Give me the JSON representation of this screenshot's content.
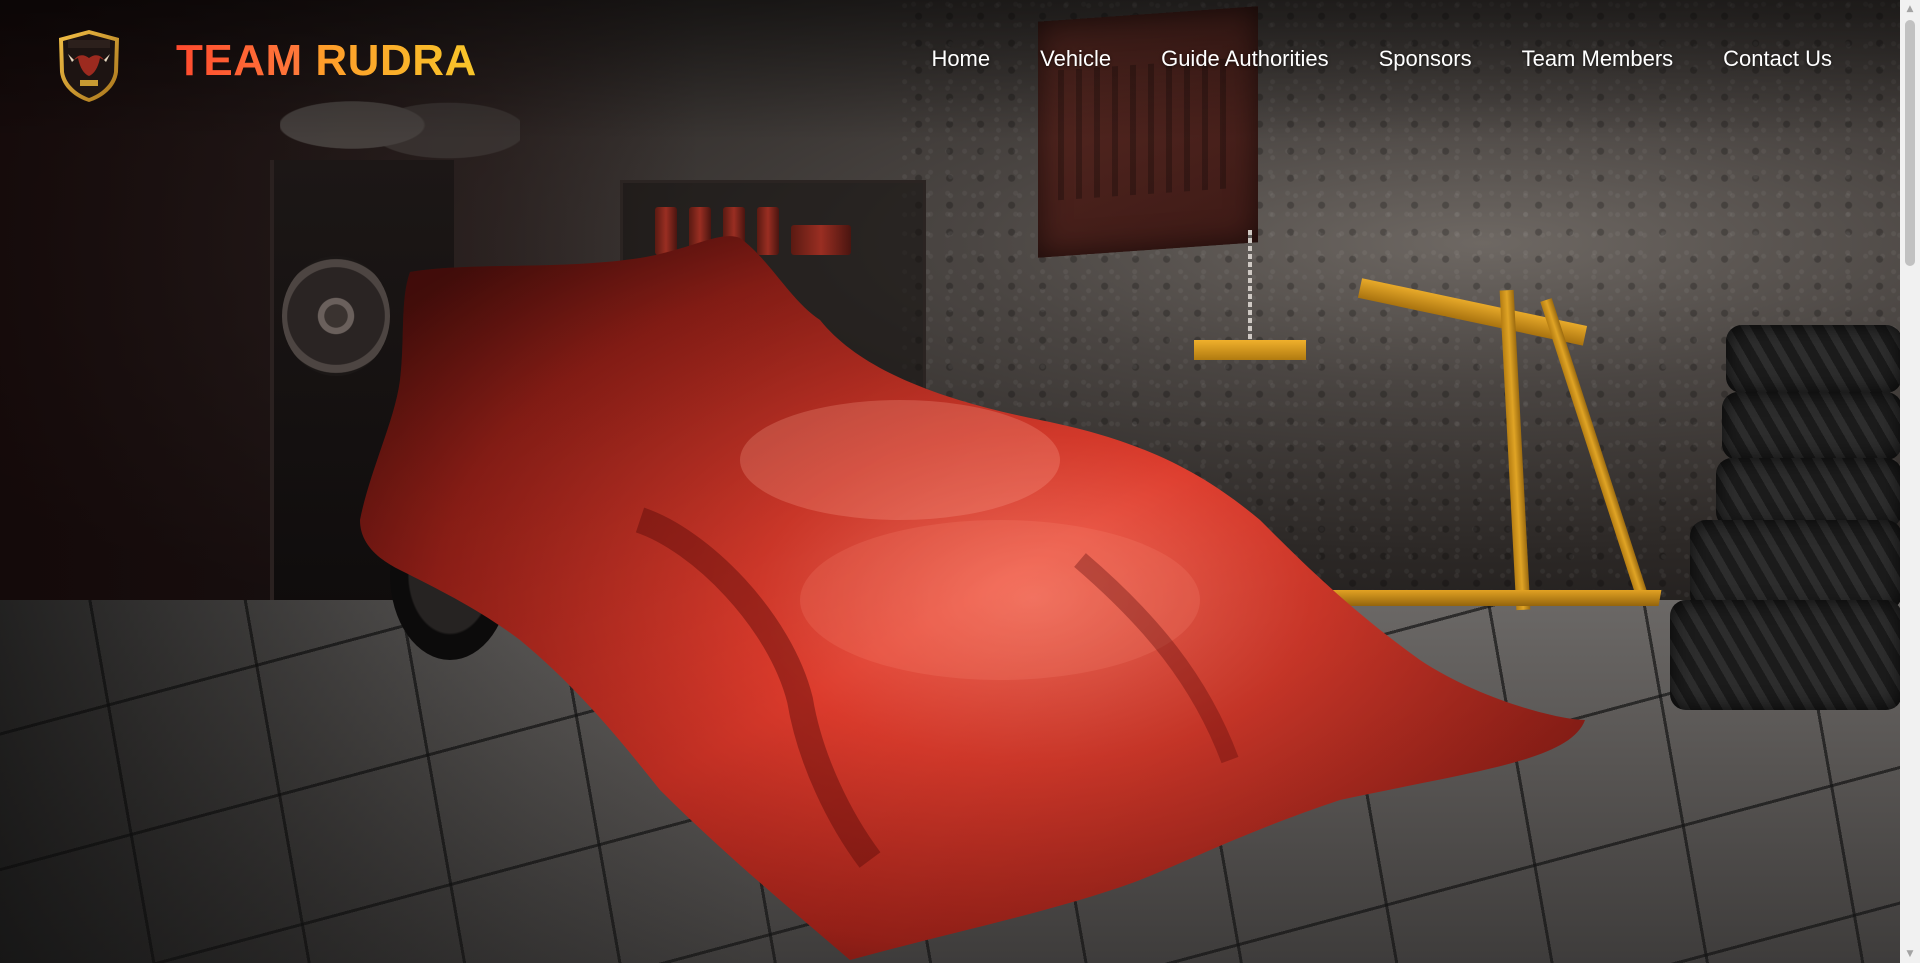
{
  "brand": {
    "word1": "TEAM",
    "word2": "RUDRA",
    "logo_icon": "team-rudra-bull-shield-logo"
  },
  "nav": {
    "items": [
      {
        "label": "Home"
      },
      {
        "label": "Vehicle"
      },
      {
        "label": "Guide Authorities"
      },
      {
        "label": "Sponsors"
      },
      {
        "label": "Team Members"
      },
      {
        "label": "Contact Us"
      }
    ]
  },
  "hero": {
    "image_subject": "red-covered-race-car-in-garage"
  },
  "colors": {
    "brand_red": "#ff4a2e",
    "brand_orange": "#ff9a2a",
    "brand_yellow": "#f7c62a",
    "nav_text": "#ffffff",
    "cover_red": "#d3382a"
  },
  "scrollbar": {
    "up_icon": "scroll-up-arrow-icon",
    "down_icon": "scroll-down-arrow-icon"
  }
}
